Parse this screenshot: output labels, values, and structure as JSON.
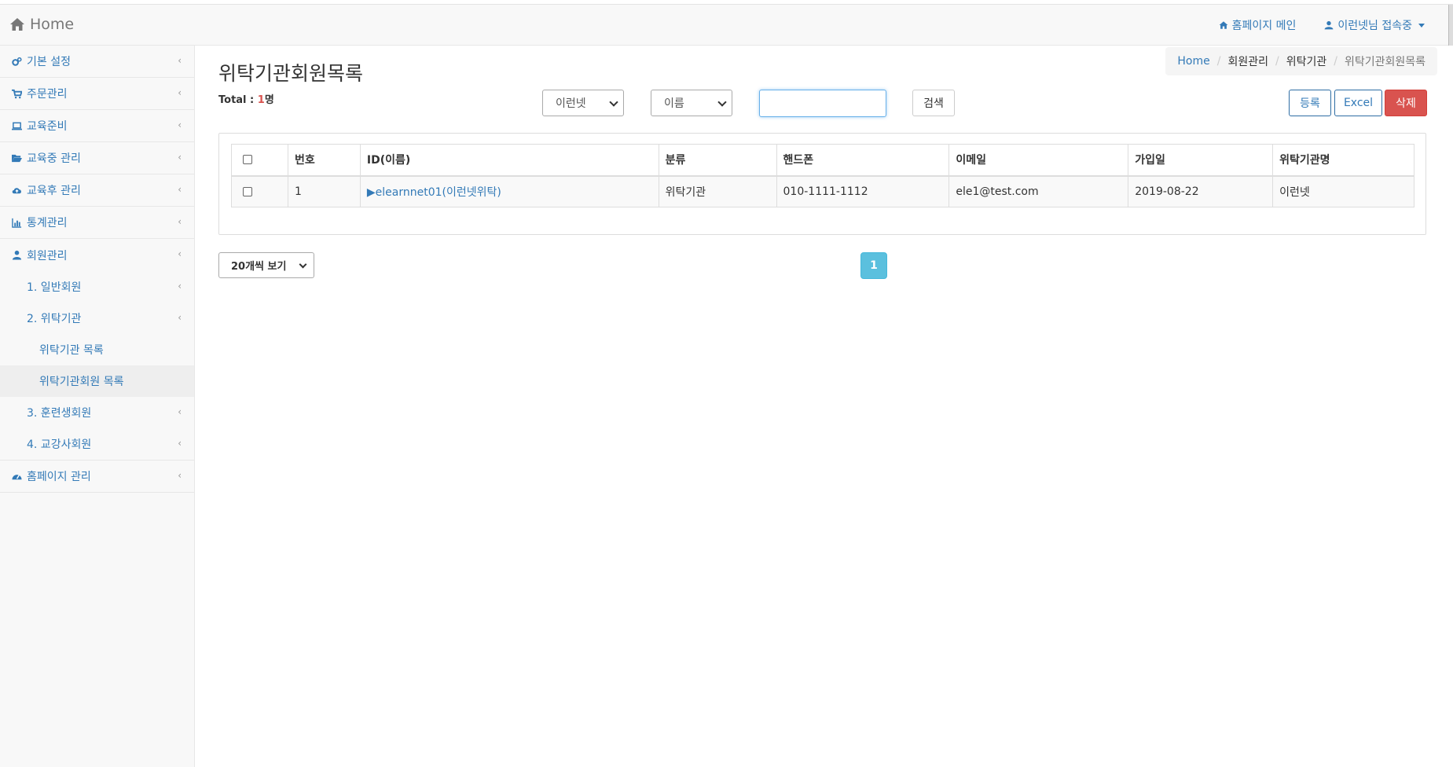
{
  "navbar": {
    "brand": "Home",
    "homepage_link": "홈페이지 메인",
    "user_menu": "이런넷님 접속중"
  },
  "sidebar": {
    "items": [
      {
        "label": "기본 설정",
        "icon": "cogs-icon"
      },
      {
        "label": "주문관리",
        "icon": "cart-icon"
      },
      {
        "label": "교육준비",
        "icon": "laptop-icon"
      },
      {
        "label": "교육중 관리",
        "icon": "folder-open-icon"
      },
      {
        "label": "교육후 관리",
        "icon": "cloud-upload-icon"
      },
      {
        "label": "통계관리",
        "icon": "bar-chart-icon"
      },
      {
        "label": "회원관리",
        "icon": "user-icon"
      }
    ],
    "member_sub": [
      {
        "label": "1. 일반회원"
      },
      {
        "label": "2. 위탁기관"
      }
    ],
    "consign_sub": [
      {
        "label": "위탁기관 목록"
      },
      {
        "label": "위탁기관회원 목록"
      }
    ],
    "member_sub_after": [
      {
        "label": "3. 훈련생회원"
      },
      {
        "label": "4. 교강사회원"
      }
    ],
    "last_item": {
      "label": "홈페이지 관리",
      "icon": "dashboard-icon"
    }
  },
  "main": {
    "title": "위탁기관회원목록",
    "total_label": "Total : ",
    "total_count": "1",
    "total_unit": "명",
    "breadcrumb": [
      "Home",
      "회원관리",
      "위탁기관",
      "위탁기관회원목록"
    ]
  },
  "filters": {
    "org_select": "이런넷",
    "field_select": "이름",
    "search_value": "",
    "search_button": "검색"
  },
  "actions": {
    "register": "등록",
    "excel": "Excel",
    "delete": "삭제"
  },
  "table": {
    "headers": [
      "번호",
      "ID(이름)",
      "분류",
      "핸드폰",
      "이메일",
      "가입일",
      "위탁기관명"
    ],
    "rows": [
      {
        "no": "1",
        "id": "▶elearnnet01(이런넷위탁)",
        "category": "위탁기관",
        "phone": "010-1111-1112",
        "email": "ele1@test.com",
        "joined": "2019-08-22",
        "org": "이런넷"
      }
    ]
  },
  "pagination": {
    "page_size": "20개씩 보기",
    "current_page": "1"
  }
}
